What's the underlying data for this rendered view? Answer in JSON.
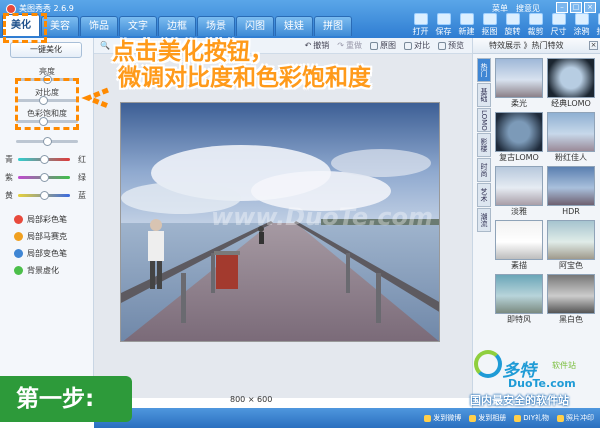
{
  "app": {
    "title": "美图秀秀 2.6.9"
  },
  "tabs": [
    {
      "label": "美化",
      "active": true
    },
    {
      "label": "美容"
    },
    {
      "label": "饰品"
    },
    {
      "label": "文字"
    },
    {
      "label": "边框"
    },
    {
      "label": "场景"
    },
    {
      "label": "闪图"
    },
    {
      "label": "娃娃"
    },
    {
      "label": "拼图"
    }
  ],
  "menu_links": [
    "菜单",
    "搜意见"
  ],
  "toolbar": [
    "打开",
    "保存",
    "新建",
    "抠图",
    "旋转",
    "裁剪",
    "尺寸",
    "涂鸦",
    "拍照"
  ],
  "annotation": {
    "line1": "点击美化按钮，",
    "line2": "微调对比度和色彩饱和度"
  },
  "left_panel": {
    "one_click": "一键美化",
    "brightness": "亮度",
    "contrast": "对比度",
    "saturation": "色彩饱和度",
    "levels": {
      "brightness": 0.5,
      "contrast": 0.45,
      "saturation": 0.45,
      "cyan_red": 0.5,
      "magenta_green": 0.5,
      "yellow_blue": 0.5
    },
    "color_left": [
      "青",
      "紫",
      "黄"
    ],
    "color_right": [
      "红",
      "绿",
      "蓝"
    ],
    "brushes": [
      "局部彩色笔",
      "局部马赛克",
      "局部变色笔",
      "背景虚化"
    ]
  },
  "main_toolbar": {
    "undo": "撤销",
    "redo": "重做",
    "original": "原图",
    "compare": "对比",
    "preview": "预览"
  },
  "photo": {
    "size": "800 × 600",
    "watermark": "www.DuoTe.com"
  },
  "right_panel": {
    "header": "特效展示 》热门特效",
    "vertical_tabs": [
      "热门",
      "基础",
      "LOMO",
      "影楼",
      "时尚",
      "艺术",
      "潮流"
    ],
    "effects": [
      "柔光",
      "经典LOMO",
      "复古LOMO",
      "粉红佳人",
      "淡雅",
      "HDR",
      "素描",
      "阿宝色",
      "即特风",
      "黑白色"
    ]
  },
  "status_bar": [
    "发到微博",
    "发到相册",
    "DIY礼物",
    "照片冲印"
  ],
  "step_banner": "第一步:",
  "watermark": {
    "brand": "多特",
    "sub": "软件站",
    "url": "DuoTe.com",
    "slogan": "国内最安全的软件站"
  }
}
